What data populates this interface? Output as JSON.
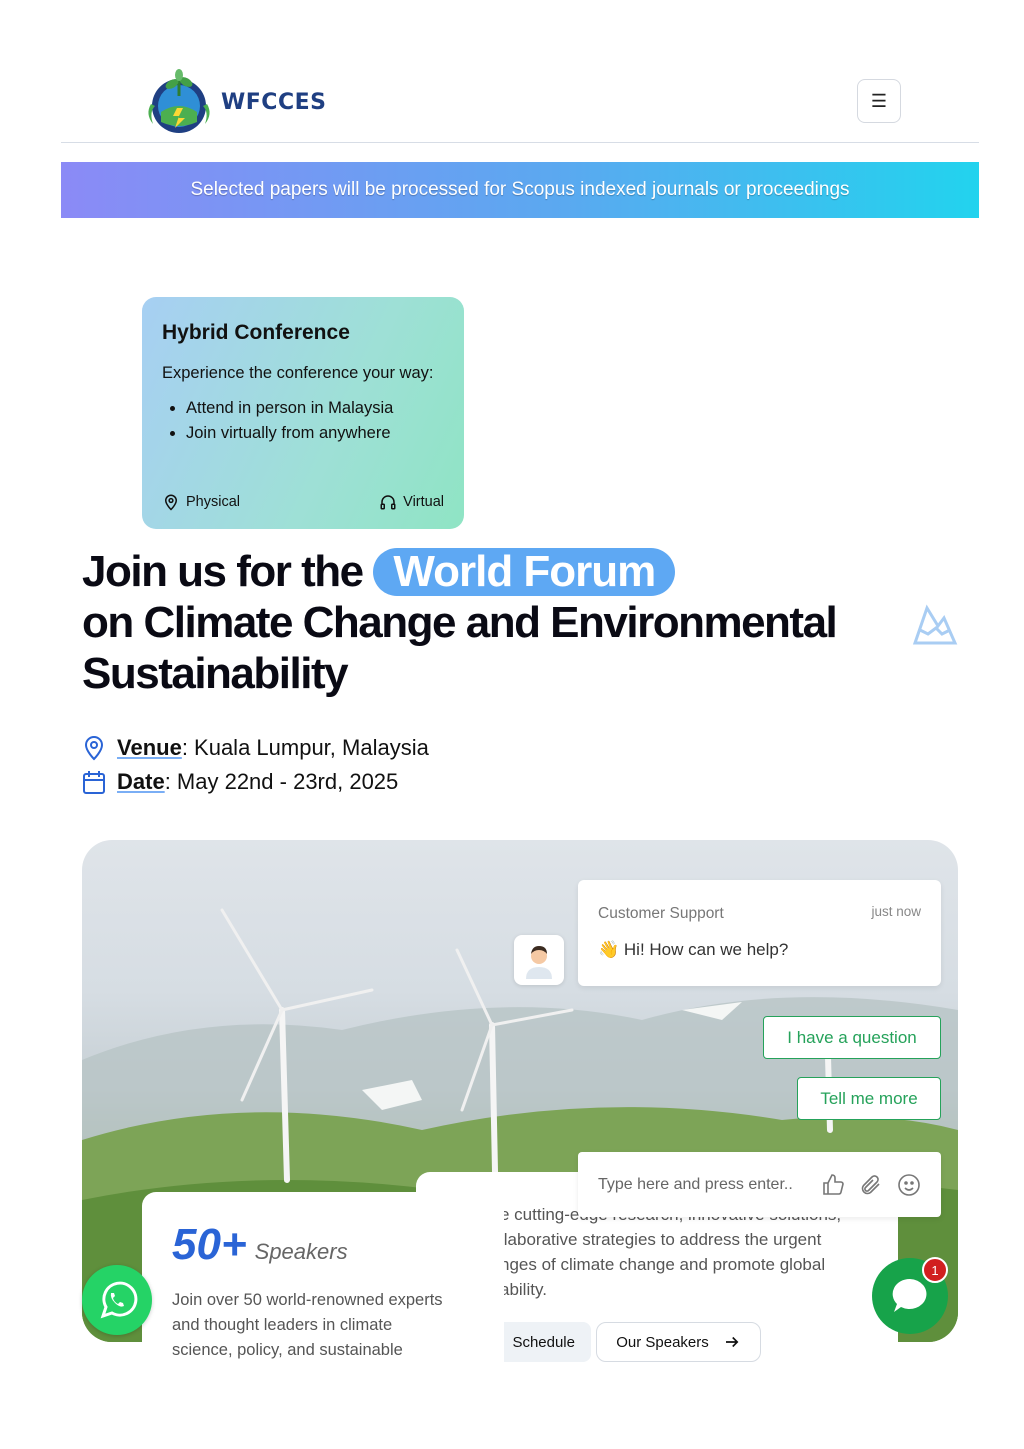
{
  "header": {
    "logo_text": "WFCCES",
    "menu_icon": "hamburger-icon"
  },
  "banner": {
    "text": "Selected papers will be processed for Scopus indexed journals or proceedings"
  },
  "hybrid": {
    "title": "Hybrid Conference",
    "intro": "Experience the conference your way:",
    "bullets": [
      "Attend in person in Malaysia",
      "Join virtually from anywhere"
    ],
    "physical_label": "Physical",
    "virtual_label": "Virtual"
  },
  "headline": {
    "prefix": "Join us for the",
    "highlight": "World Forum",
    "line2": "on Climate Change and Environmental",
    "line3": "Sustainability"
  },
  "meta": {
    "venue_label": "Venue",
    "venue_value": ": Kuala Lumpur, Malaysia",
    "date_label": "Date",
    "date_value": ": May 22nd - 23rd, 2025"
  },
  "speakers": {
    "count": "50+",
    "label": "Speakers",
    "desc_lines": [
      "Join over 50 world-renowned experts",
      "and thought leaders in climate",
      "science, policy, and sustainable"
    ]
  },
  "info": {
    "lines": [
      "e cutting-edge research, innovative solutions,",
      "llaborative strategies to address the urgent",
      "nges of climate change and promote global",
      "ability."
    ],
    "schedule_label": "Schedule",
    "speakers_btn_label": "Our Speakers"
  },
  "chat": {
    "agent_name": "Customer Support",
    "time": "just now",
    "greeting": "👋 Hi! How can we help?",
    "option1": "I have a question",
    "option2": "Tell me more",
    "input_placeholder": "Type here and press enter..",
    "badge_count": "1"
  },
  "colors": {
    "accent_blue": "#2a64d6",
    "pill_blue": "#5ea8f3",
    "chat_green": "#25a25a",
    "whatsapp_green": "#25d366",
    "badge_red": "#d11f1f"
  }
}
